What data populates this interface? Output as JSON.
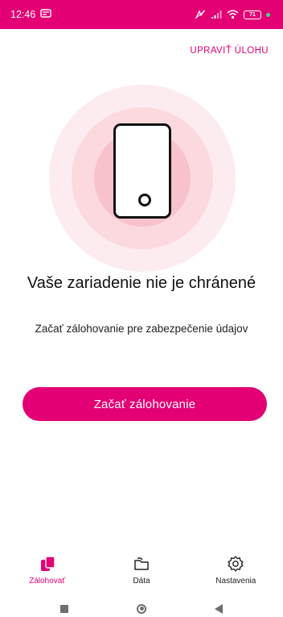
{
  "status_bar": {
    "time": "12:46",
    "battery": "71",
    "icons": [
      "notification-icon",
      "vibrate-icon",
      "signal-icon",
      "wifi-icon",
      "battery-icon"
    ]
  },
  "header": {
    "edit_link": "UPRAVIŤ ÚLOHU"
  },
  "main": {
    "title": "Vaše zariadenie nie je chránené",
    "subtitle": "Začať zálohovanie pre zabezpečenie údajov",
    "cta_label": "Začať zálohovanie",
    "illustration_icon": "phone-icon"
  },
  "bottom_nav": {
    "items": [
      {
        "label": "Zálohovať",
        "icon": "backup-icon",
        "active": true
      },
      {
        "label": "Dáta",
        "icon": "folder-icon",
        "active": false
      },
      {
        "label": "Nastavenia",
        "icon": "gear-icon",
        "active": false
      }
    ]
  },
  "colors": {
    "accent": "#e20074",
    "ring_outer": "#fdecef",
    "ring_mid": "#fbd9df",
    "ring_inner": "#f8c2cc"
  },
  "system_nav": {
    "icons": [
      "recents-icon",
      "home-icon",
      "back-icon"
    ]
  }
}
